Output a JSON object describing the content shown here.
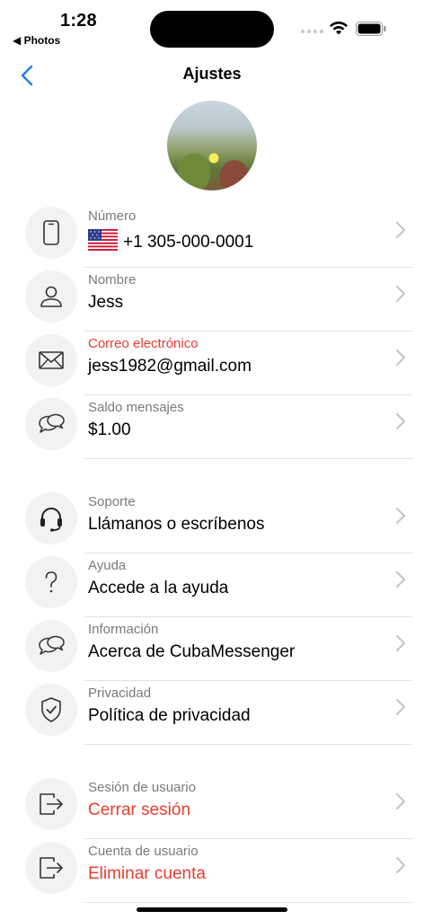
{
  "status_bar": {
    "time": "1:28",
    "back_app": "◀ Photos"
  },
  "nav": {
    "title": "Ajustes"
  },
  "rows": [
    {
      "label": "Número",
      "value": "+1 305-000-0001",
      "icon": "phone-icon"
    },
    {
      "label": "Nombre",
      "value": "Jess",
      "icon": "person-icon"
    },
    {
      "label": "Correo electrónico",
      "value": "jess1982@gmail.com",
      "icon": "envelope-icon"
    },
    {
      "label": "Saldo mensajes",
      "value": "$1.00",
      "icon": "chat-bubbles-icon"
    },
    {
      "label": "Soporte",
      "value": "Llámanos o escríbenos",
      "icon": "headset-icon"
    },
    {
      "label": "Ayuda",
      "value": "Accede a la ayuda",
      "icon": "question-icon"
    },
    {
      "label": "Información",
      "value": "Acerca de CubaMessenger",
      "icon": "chat-bubbles-icon"
    },
    {
      "label": "Privacidad",
      "value": "Política de privacidad",
      "icon": "shield-check-icon"
    },
    {
      "label": "Sesión de usuario",
      "value": "Cerrar sesión",
      "icon": "sign-out-icon"
    },
    {
      "label": "Cuenta de usuario",
      "value": "Eliminar cuenta",
      "icon": "sign-out-icon"
    }
  ],
  "colors": {
    "accent": "#1a7ff0",
    "danger": "#ec3b30",
    "icon_bg": "#f2f2f2"
  }
}
